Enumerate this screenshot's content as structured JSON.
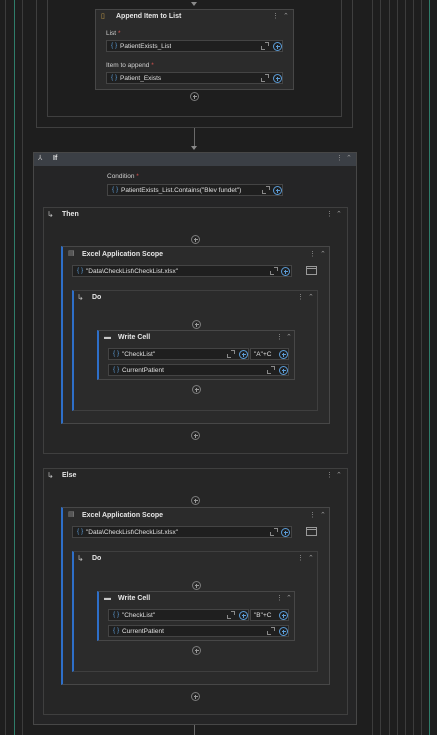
{
  "append_activity": {
    "title": "Append Item to List",
    "list_label": "List",
    "list_value": "PatientExists_List",
    "item_label": "Item to append",
    "item_value": "Patient_Exists"
  },
  "if_activity": {
    "title": "If",
    "condition_label": "Condition",
    "condition_value": "PatientExists_List.Contains(\"Blev fundet\")",
    "then_label": "Then",
    "else_label": "Else"
  },
  "then_scope": {
    "title": "Excel Application Scope",
    "path": "\"Data\\CheckList\\CheckList.xlsx\"",
    "do_label": "Do",
    "write_cell": {
      "title": "Write Cell",
      "sheet": "\"CheckList\"",
      "range": "\"A\"+C",
      "value": "CurrentPatient"
    }
  },
  "else_scope": {
    "title": "Excel Application Scope",
    "path": "\"Data\\CheckList\\CheckList.xlsx\"",
    "do_label": "Do",
    "write_cell": {
      "title": "Write Cell",
      "sheet": "\"CheckList\"",
      "range": "\"B\"+C",
      "value": "CurrentPatient"
    }
  },
  "icons": {
    "menu": "⋮",
    "collapse": "⌃",
    "brace": "{ }",
    "branch": "↳",
    "if": "⅄",
    "required_mark": "*"
  },
  "colors": {
    "background": "#1e1e1e",
    "card": "#2b2b2b",
    "accent_blue": "#2e6fc9",
    "required_red": "#d9534f",
    "brace_blue": "#5b9bd5"
  }
}
